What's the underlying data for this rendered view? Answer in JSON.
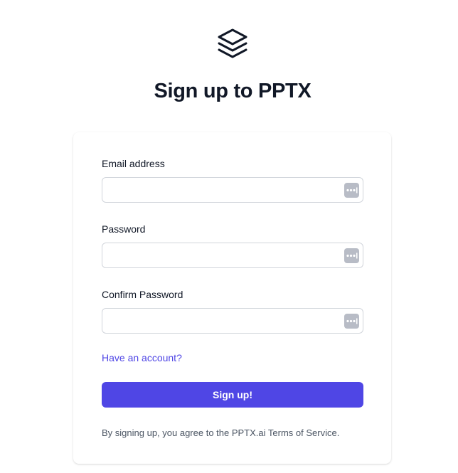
{
  "app": {
    "logo_icon": "layers-icon",
    "title": "Sign up to PPTX"
  },
  "form": {
    "email": {
      "label": "Email address",
      "value": "",
      "placeholder": "",
      "icon": "password-manager-icon"
    },
    "password": {
      "label": "Password",
      "value": "",
      "placeholder": "",
      "icon": "password-manager-icon"
    },
    "confirm_password": {
      "label": "Confirm Password",
      "value": "",
      "placeholder": "",
      "icon": "password-manager-icon"
    },
    "have_account_link": "Have an account?",
    "submit_label": "Sign up!",
    "terms_text": "By signing up, you agree to the PPTX.ai Terms of Service."
  },
  "colors": {
    "accent": "#4f46e5",
    "text": "#111827",
    "muted_text": "#4b5563",
    "input_border": "#d1d5db",
    "icon_bg": "#b8bcc6"
  }
}
